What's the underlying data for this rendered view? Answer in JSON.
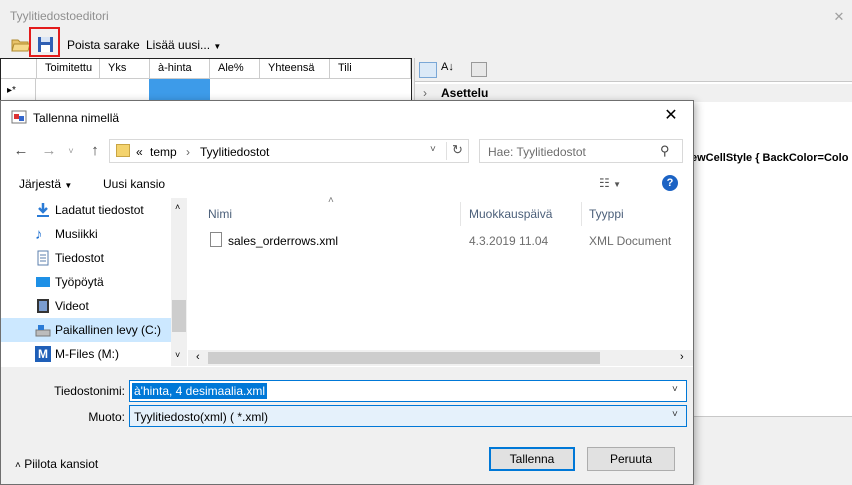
{
  "app": {
    "title": "Tyylitiedostoeditori",
    "toolbar": {
      "delete_column": "Poista sarake",
      "add_new": "Lisää uusi..."
    },
    "grid": {
      "columns": [
        "Toimitettu",
        "Yks",
        "à-hinta",
        "Ale%",
        "Yhteensä",
        "Tili"
      ],
      "new_row_marker": "▸*"
    },
    "properties": {
      "category": "Asettelu",
      "style_text": "ewCellStyle { BackColor=Colo"
    }
  },
  "dialog": {
    "title": "Tallenna nimellä",
    "breadcrumb": {
      "prefix": "«",
      "parts": [
        "temp",
        "Tyylitiedostot"
      ]
    },
    "search_placeholder": "Hae: Tyylitiedostot",
    "organize": "Järjestä",
    "new_folder": "Uusi kansio",
    "tree": [
      {
        "label": "Ladatut tiedostot",
        "icon": "download-icon"
      },
      {
        "label": "Musiikki",
        "icon": "music-icon"
      },
      {
        "label": "Tiedostot",
        "icon": "documents-icon"
      },
      {
        "label": "Työpöytä",
        "icon": "desktop-icon"
      },
      {
        "label": "Videot",
        "icon": "video-icon"
      },
      {
        "label": "Paikallinen levy (C:)",
        "icon": "drive-icon"
      },
      {
        "label": "M-Files (M:)",
        "icon": "mfiles-icon"
      }
    ],
    "columns": {
      "name": "Nimi",
      "modified": "Muokkauspäivä",
      "type": "Tyyppi"
    },
    "files": [
      {
        "name": "sales_orderrows.xml",
        "modified": "4.3.2019 11.04",
        "type": "XML Document"
      }
    ],
    "filename_label": "Tiedostonimi:",
    "filename_value": "à'hinta, 4 desimaalia.xml",
    "format_label": "Muoto:",
    "format_value": "Tyylitiedosto(xml) ( *.xml)",
    "hide_folders": "Piilota kansiot",
    "save_button": "Tallenna",
    "cancel_button": "Peruuta",
    "colors": {
      "accent": "#0078d7",
      "selection": "#cce8ff",
      "highlight_box": "#e31b1b"
    }
  }
}
